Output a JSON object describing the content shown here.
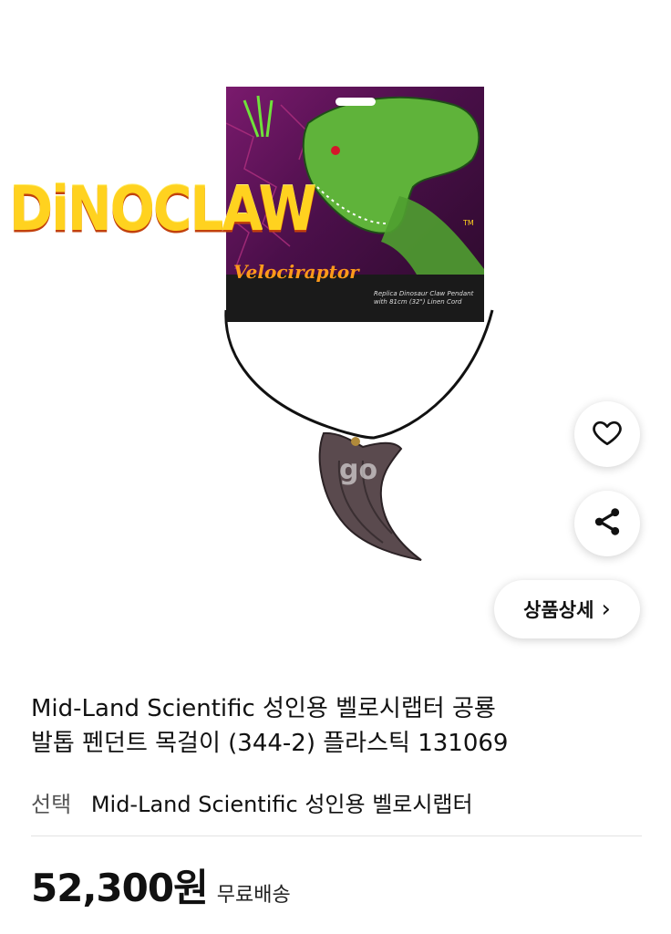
{
  "product_image": {
    "card_brand": "DiNOCLAW",
    "card_trademark": "TM",
    "card_subtitle": "Velociraptor",
    "card_description": "Replica Dinosaur Claw Pendant with 81cm (32\") Linen Cord",
    "watermark": "go"
  },
  "actions": {
    "detail_label": "상품상세",
    "detail_chevron": "›",
    "like_icon": "heart-outline",
    "share_icon": "share-nodes"
  },
  "product": {
    "title_line1": "Mid-Land Scientific 성인용 벨로시랩터 공룡",
    "title_line2": "발톱 펜던트 목걸이 (344-2) 플라스틱 131069",
    "option_label": "선택",
    "option_value": "Mid-Land Scientific 성인용 벨로시랩터",
    "price": "52,300원",
    "shipping": "무료배송"
  }
}
